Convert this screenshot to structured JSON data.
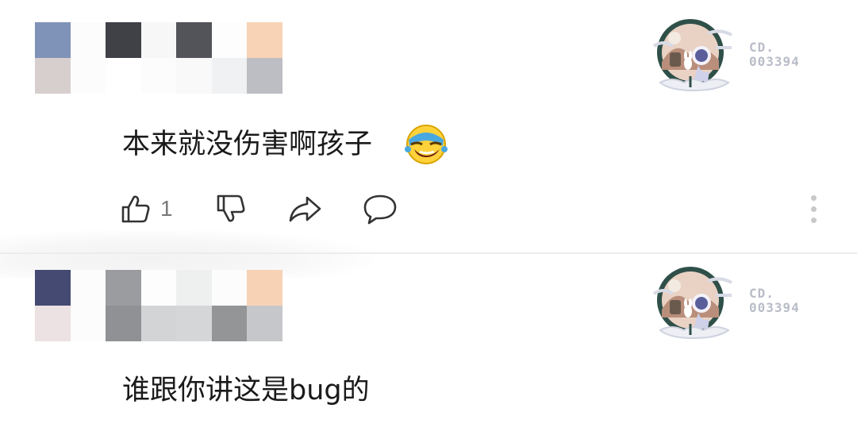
{
  "comments": [
    {
      "author_mosaic_colors": [
        "#7f93b8",
        "#d7cfce",
        "#fcfcfc",
        "#fcfcfc",
        "#3f4147",
        "#ffffff",
        "#f7f7f8",
        "#fcfcfc",
        "#525459",
        "#f9f9fa",
        "#fdfdfd",
        "#f0f1f2",
        "#f8d3b5",
        "#bdbec3"
      ],
      "badge_line1": "CD.",
      "badge_line2": "003394",
      "text": "本来就没伤害啊孩子",
      "emoji": "laughing-tears-emoji",
      "like_count": "1"
    },
    {
      "author_mosaic_colors": [
        "#444a72",
        "#ece2e3",
        "#fcfcfc",
        "#fcfcfc",
        "#9a9c9f",
        "#8f9194",
        "#fdfdfd",
        "#d3d4d6",
        "#eeefef",
        "#d5d6d8",
        "#fcfcfc",
        "#939597",
        "#f7d2b5",
        "#c6c7ca"
      ],
      "badge_line1": "CD.",
      "badge_line2": "003394",
      "text": "谁跟你讲这是bug的"
    }
  ],
  "icons": {
    "like": "thumbs-up-icon",
    "dislike": "thumbs-down-icon",
    "share": "share-icon",
    "reply": "comment-icon",
    "more": "more-vertical-icon"
  }
}
